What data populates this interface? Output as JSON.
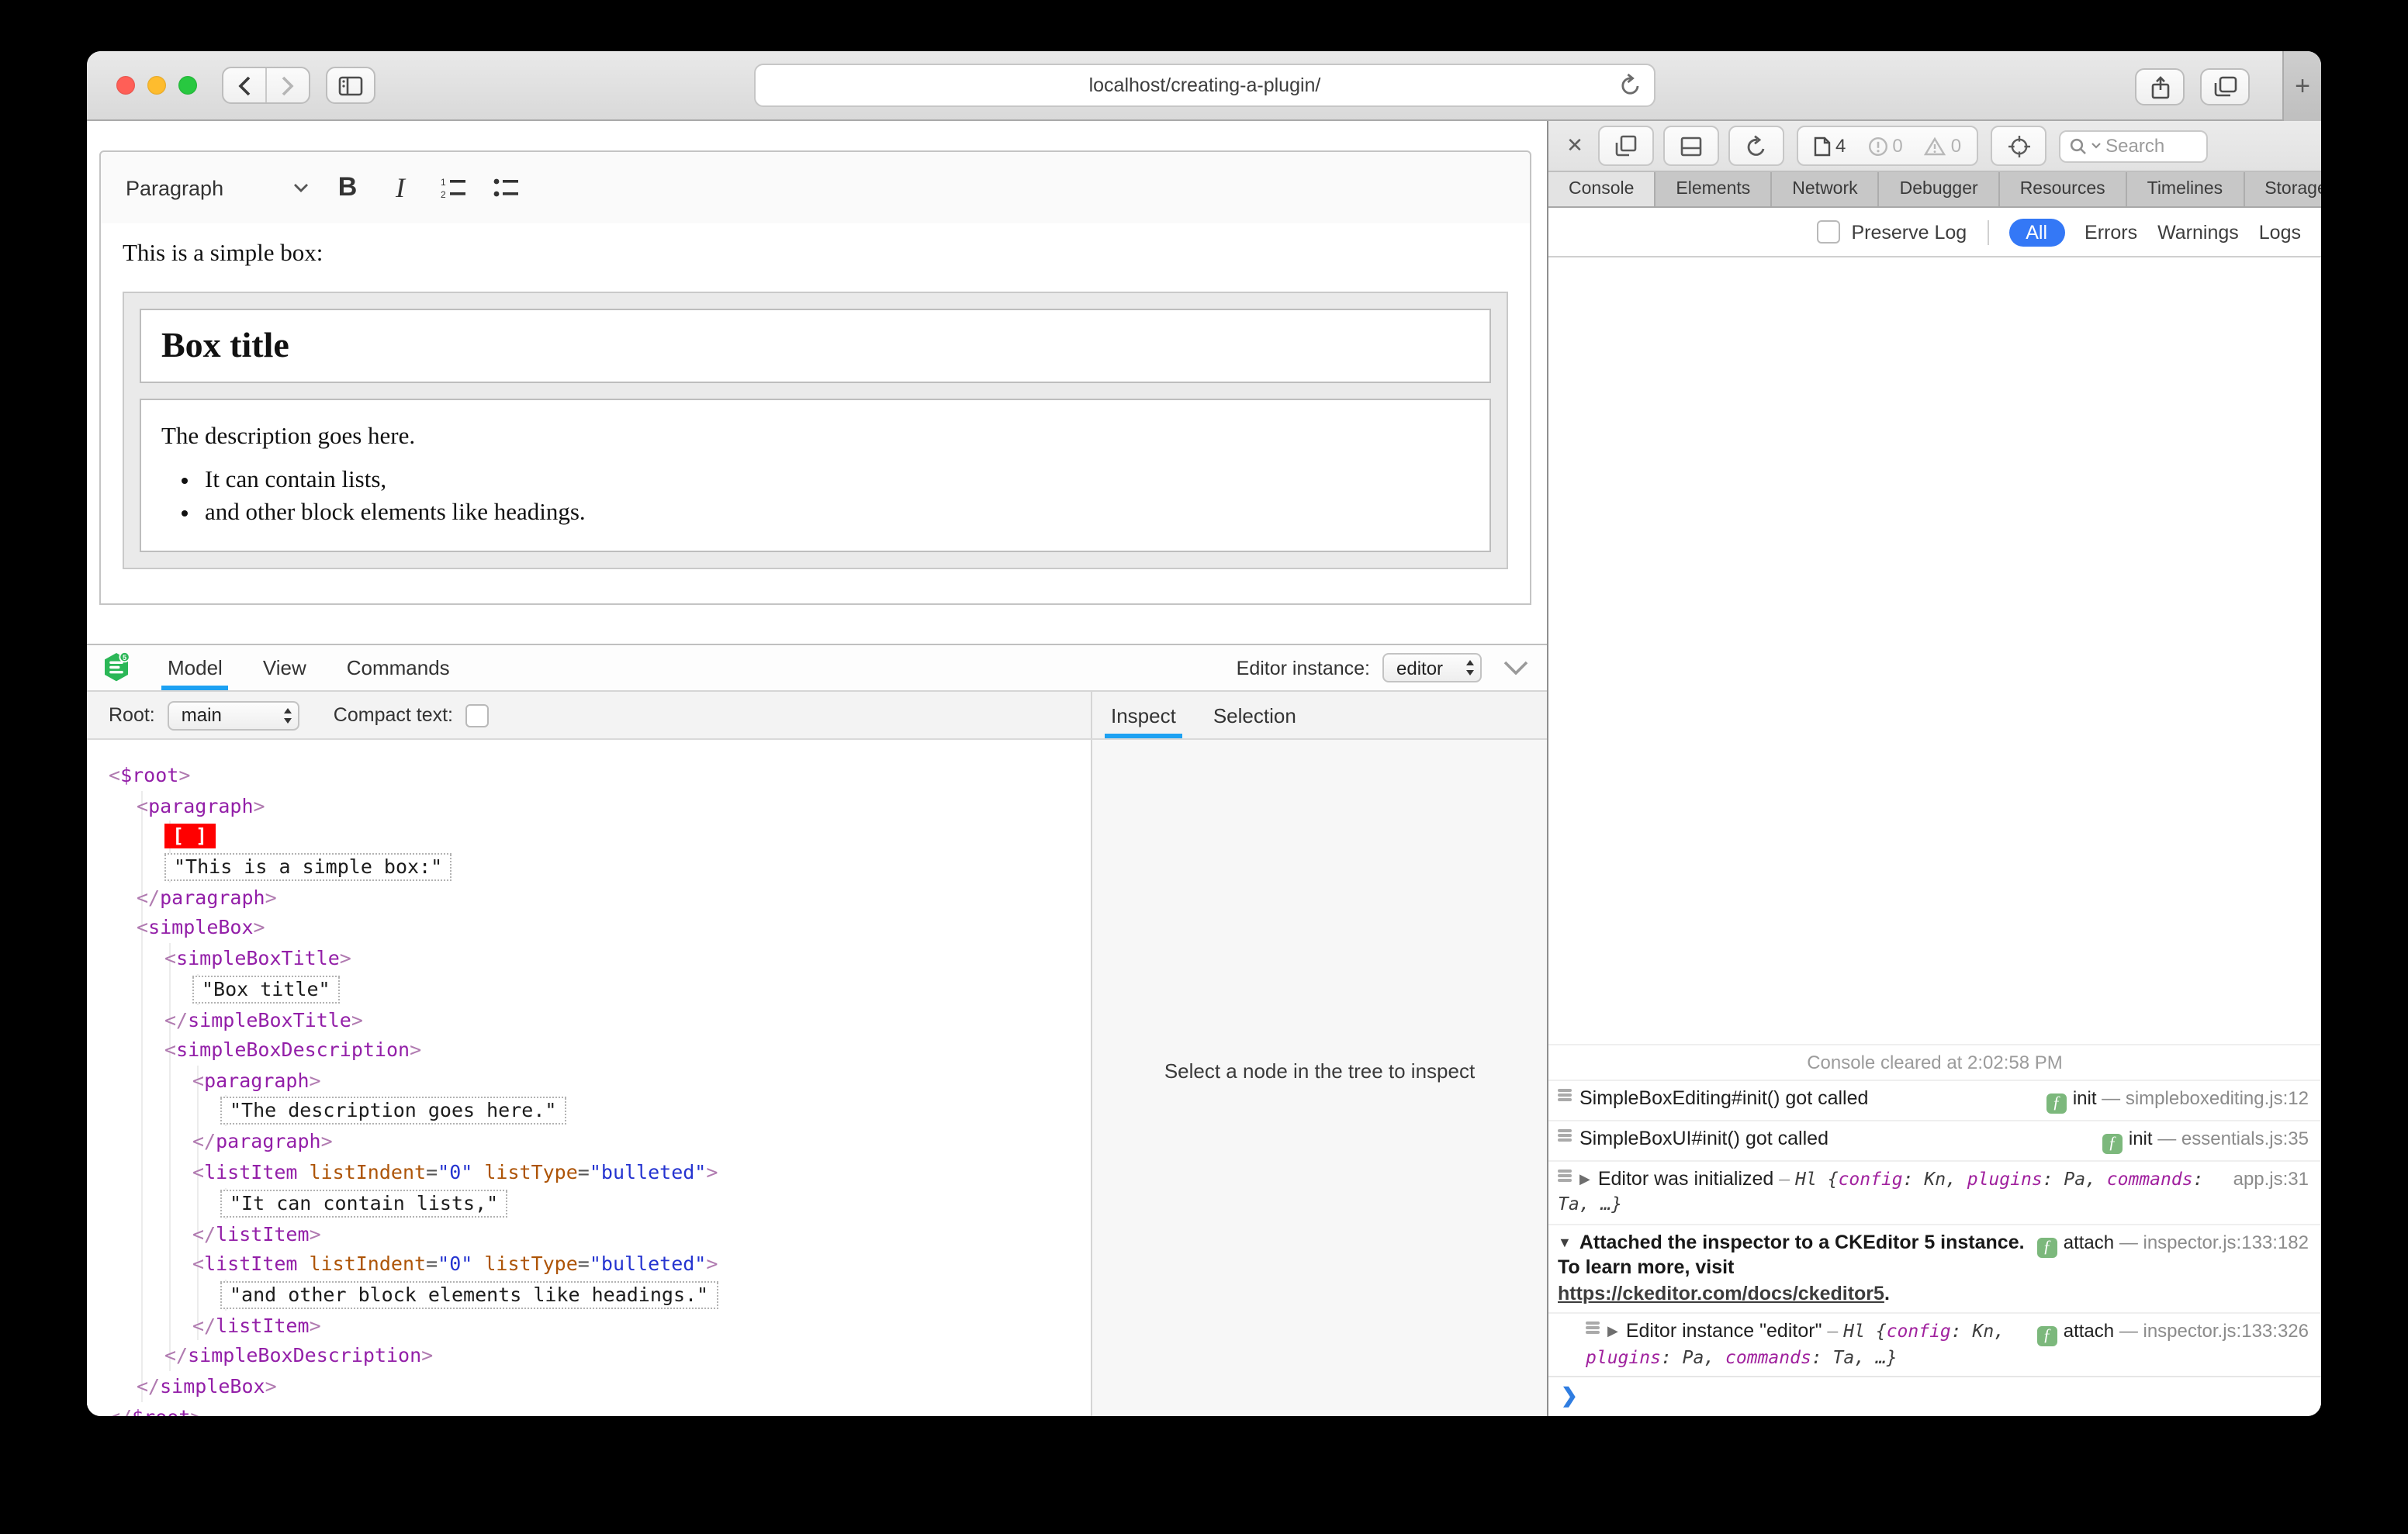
{
  "browser": {
    "url": "localhost/creating-a-plugin/"
  },
  "icons": {
    "close": "✕",
    "overflow": "»",
    "plus": "+",
    "gear": "⚙",
    "prompt": "❯"
  },
  "editor": {
    "toolbar": {
      "paragraph": "Paragraph",
      "bold": "B",
      "italic": "I"
    },
    "content": {
      "intro": "This is a simple box:",
      "box_title": "Box title",
      "description": "The description goes here.",
      "list": [
        "It can contain lists,",
        "and other block elements like headings."
      ]
    }
  },
  "inspector": {
    "logo_badge": "5",
    "tabs": [
      "Model",
      "View",
      "Commands"
    ],
    "active_tab": "Model",
    "editor_instance_label": "Editor instance:",
    "editor_instance_value": "editor",
    "root_label": "Root:",
    "root_value": "main",
    "compact_label": "Compact text:",
    "side_tabs": [
      "Inspect",
      "Selection"
    ],
    "active_side_tab": "Inspect",
    "empty_message": "Select a node in the tree to inspect",
    "tree": [
      {
        "i": 0,
        "k": "open",
        "n": "$root"
      },
      {
        "i": 1,
        "k": "open",
        "n": "paragraph"
      },
      {
        "i": 2,
        "k": "sel"
      },
      {
        "i": 2,
        "k": "text",
        "t": "This is a simple box:"
      },
      {
        "i": 1,
        "k": "close",
        "n": "paragraph"
      },
      {
        "i": 1,
        "k": "open",
        "n": "simpleBox"
      },
      {
        "i": 2,
        "k": "open",
        "n": "simpleBoxTitle"
      },
      {
        "i": 3,
        "k": "text",
        "t": "Box title"
      },
      {
        "i": 2,
        "k": "close",
        "n": "simpleBoxTitle"
      },
      {
        "i": 2,
        "k": "open",
        "n": "simpleBoxDescription"
      },
      {
        "i": 3,
        "k": "open",
        "n": "paragraph"
      },
      {
        "i": 4,
        "k": "text",
        "t": "The description goes here."
      },
      {
        "i": 3,
        "k": "close",
        "n": "paragraph"
      },
      {
        "i": 3,
        "k": "open",
        "n": "listItem",
        "a": [
          [
            "listIndent",
            "0"
          ],
          [
            "listType",
            "bulleted"
          ]
        ]
      },
      {
        "i": 4,
        "k": "text",
        "t": "It can contain lists,"
      },
      {
        "i": 3,
        "k": "close",
        "n": "listItem"
      },
      {
        "i": 3,
        "k": "open",
        "n": "listItem",
        "a": [
          [
            "listIndent",
            "0"
          ],
          [
            "listType",
            "bulleted"
          ]
        ]
      },
      {
        "i": 4,
        "k": "text",
        "t": "and other block elements like headings."
      },
      {
        "i": 3,
        "k": "close",
        "n": "listItem"
      },
      {
        "i": 2,
        "k": "close",
        "n": "simpleBoxDescription"
      },
      {
        "i": 1,
        "k": "close",
        "n": "simpleBox"
      },
      {
        "i": 0,
        "k": "close",
        "n": "$root"
      }
    ]
  },
  "devtools": {
    "toolbar": {
      "page_count": "4",
      "error_count": "0",
      "warning_count": "0",
      "search_placeholder": "Search"
    },
    "tabs": [
      "Console",
      "Elements",
      "Network",
      "Debugger",
      "Resources",
      "Timelines",
      "Storage"
    ],
    "active_tab": "Console",
    "filter": {
      "preserve": "Preserve Log",
      "options": [
        "All",
        "Errors",
        "Warnings",
        "Logs"
      ],
      "active": "All"
    },
    "console": {
      "cleared": "Console cleared at 2:02:58 PM",
      "rows": [
        {
          "icon": true,
          "text": "SimpleBoxEditing#init() got called",
          "badge": "init",
          "location": "simpleboxediting.js:12"
        },
        {
          "icon": true,
          "text": "SimpleBoxUI#init() got called",
          "badge": "init",
          "location": "essentials.js:35"
        },
        {
          "icon": true,
          "disclosure": "collapsed",
          "text": "Editor was initialized",
          "dash": " – ",
          "obj": {
            "cls": "Hl",
            "props": [
              [
                "config",
                "Kn"
              ],
              [
                "plugins",
                "Pa"
              ],
              [
                "commands",
                "Ta"
              ]
            ],
            "ellipsis": ", …}"
          },
          "location": "app.js:31"
        },
        {
          "disclosure": "expanded",
          "bold": true,
          "text": "Attached the inspector to a CKEditor 5 instance. To learn more, visit ",
          "link": "https://ckeditor.com/docs/ckeditor5",
          "suffix": ".",
          "badge": "attach",
          "location": "inspector.js:133:182"
        },
        {
          "icon": true,
          "nested": true,
          "disclosure": "collapsed",
          "text": "Editor instance \"editor\"",
          "dash": " – ",
          "obj": {
            "cls": "Hl",
            "props": [
              [
                "config",
                "Kn"
              ],
              [
                "plugins",
                "Pa"
              ],
              [
                "commands",
                "Ta"
              ]
            ],
            "ellipsis": ", …}"
          },
          "badge": "attach",
          "location": "inspector.js:133:326"
        }
      ]
    }
  },
  "colors": {
    "accent_blue": "#1da1f2",
    "filter_blue": "#3478f6",
    "selection_red": "#ff0000",
    "badge_green": "#7cb87c",
    "logo_green": "#2bb757",
    "traffic_red": "#ff5f57",
    "traffic_yellow": "#febc2e",
    "traffic_green": "#28c840"
  }
}
